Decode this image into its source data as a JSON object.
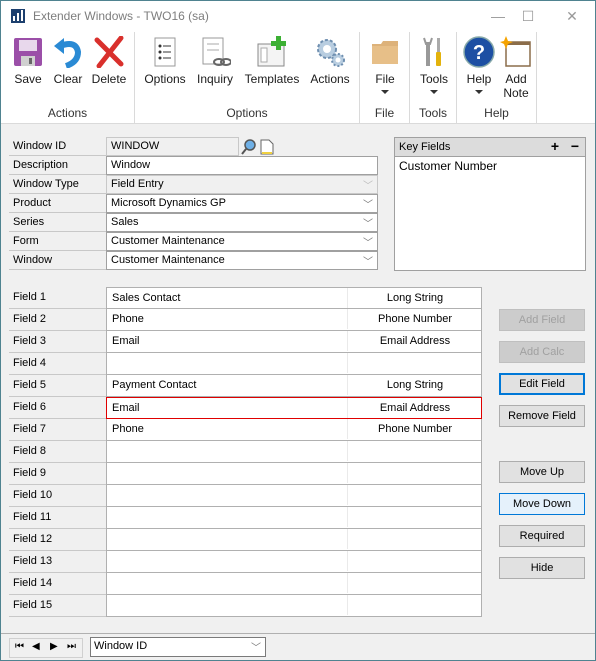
{
  "window": {
    "title": "Extender Windows  -  TWO16 (sa)",
    "controls": {
      "minimize": "—",
      "maximize": "☐",
      "close": "✕"
    }
  },
  "ribbon": {
    "groups": [
      {
        "label": "Actions",
        "buttons": [
          {
            "label": "Save",
            "icon": "save-icon"
          },
          {
            "label": "Clear",
            "icon": "undo-arrow-icon"
          },
          {
            "label": "Delete",
            "icon": "delete-x-icon"
          }
        ]
      },
      {
        "label": "Options",
        "buttons": [
          {
            "label": "Options",
            "icon": "list-document-icon"
          },
          {
            "label": "Inquiry",
            "icon": "document-link-icon"
          },
          {
            "label": "Templates",
            "icon": "window-plus-icon"
          },
          {
            "label": "Actions",
            "icon": "gears-icon"
          }
        ]
      },
      {
        "label": "File",
        "buttons": [
          {
            "label": "File",
            "icon": "folder-icon"
          }
        ]
      },
      {
        "label": "Tools",
        "buttons": [
          {
            "label": "Tools",
            "icon": "tools-icon"
          }
        ]
      },
      {
        "label": "Help",
        "buttons": [
          {
            "label": "Help",
            "icon": "help-icon"
          },
          {
            "label": "Add\nNote",
            "label_line1": "Add",
            "label_line2": "Note",
            "icon": "note-icon"
          }
        ]
      }
    ]
  },
  "form": {
    "window_id": {
      "label": "Window ID",
      "value": "WINDOW"
    },
    "description": {
      "label": "Description",
      "value": "Window"
    },
    "window_type": {
      "label": "Window Type",
      "value": "Field Entry"
    },
    "product": {
      "label": "Product",
      "value": "Microsoft Dynamics GP"
    },
    "series": {
      "label": "Series",
      "value": "Sales"
    },
    "form": {
      "label": "Form",
      "value": "Customer Maintenance"
    },
    "window": {
      "label": "Window",
      "value": "Customer Maintenance"
    }
  },
  "key_fields": {
    "header": "Key Fields",
    "add": "+",
    "remove": "−",
    "items": [
      "Customer Number"
    ]
  },
  "fields": [
    {
      "label": "Field 1",
      "name": "Sales Contact",
      "type": "Long String"
    },
    {
      "label": "Field 2",
      "name": "Phone",
      "type": "Phone Number"
    },
    {
      "label": "Field 3",
      "name": "Email",
      "type": "Email Address"
    },
    {
      "label": "Field 4",
      "name": "",
      "type": ""
    },
    {
      "label": "Field 5",
      "name": "Payment Contact",
      "type": "Long String"
    },
    {
      "label": "Field 6",
      "name": "Email",
      "type": "Email Address",
      "selected": true
    },
    {
      "label": "Field 7",
      "name": "Phone",
      "type": "Phone Number"
    },
    {
      "label": "Field 8",
      "name": "",
      "type": ""
    },
    {
      "label": "Field 9",
      "name": "",
      "type": ""
    },
    {
      "label": "Field 10",
      "name": "",
      "type": ""
    },
    {
      "label": "Field 11",
      "name": "",
      "type": ""
    },
    {
      "label": "Field 12",
      "name": "",
      "type": ""
    },
    {
      "label": "Field 13",
      "name": "",
      "type": ""
    },
    {
      "label": "Field 14",
      "name": "",
      "type": ""
    },
    {
      "label": "Field 15",
      "name": "",
      "type": ""
    }
  ],
  "side_buttons": {
    "add_field": "Add Field",
    "add_calc": "Add Calc",
    "edit_field": "Edit Field",
    "remove_field": "Remove Field",
    "move_up": "Move Up",
    "move_down": "Move Down",
    "required": "Required",
    "hide": "Hide"
  },
  "bottom": {
    "nav": {
      "first": "⏮",
      "prev": "◀",
      "next": "▶",
      "last": "⏭"
    },
    "sort_by": "Window ID"
  }
}
